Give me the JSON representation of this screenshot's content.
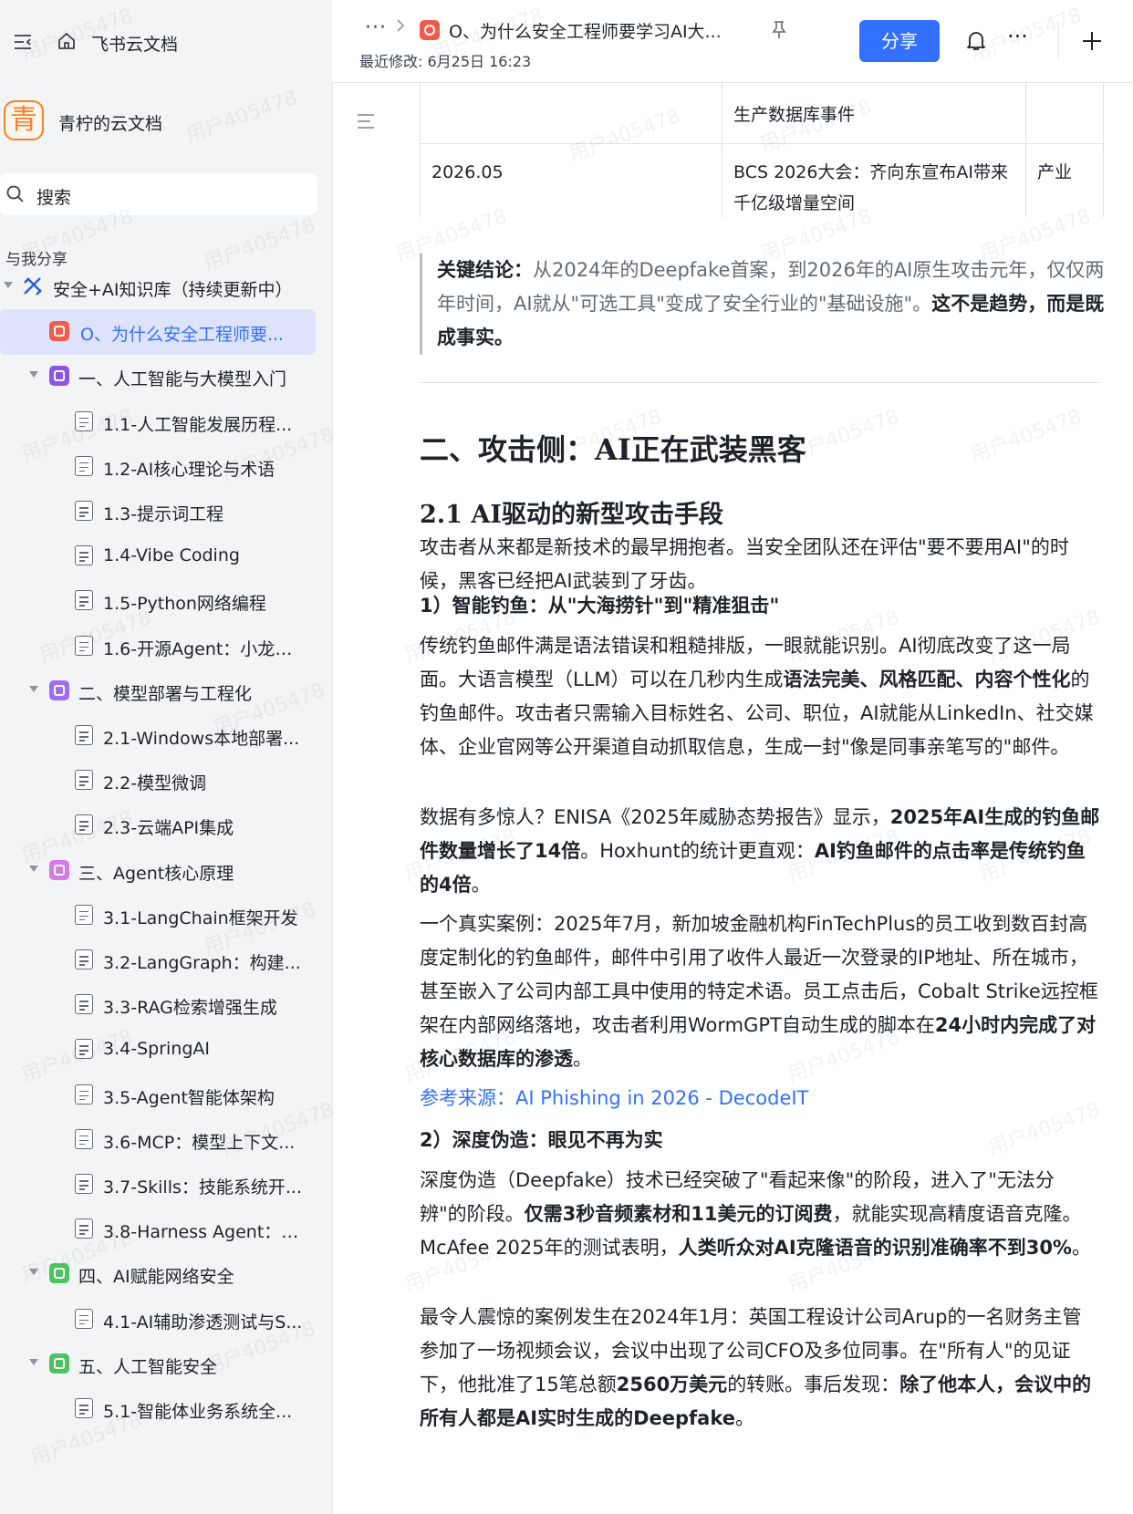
{
  "app": {
    "name": "飞书云文档"
  },
  "space": {
    "avatar_char": "青",
    "name": "青柠的云文档"
  },
  "search": {
    "label": "搜索"
  },
  "shared_label": "与我分享",
  "tree": [
    {
      "label": "安全+AI知识库（持续更新中）",
      "level": 0,
      "kind": "root"
    },
    {
      "label": "O、为什么安全工程师要...",
      "level": 1,
      "kind": "doc-red",
      "active": true
    },
    {
      "label": "一、人工智能与大模型入门",
      "level": 1,
      "kind": "folder-purple"
    },
    {
      "label": "1.1-人工智能发展历程...",
      "level": 2,
      "kind": "doc"
    },
    {
      "label": "1.2-AI核心理论与术语",
      "level": 2,
      "kind": "doc"
    },
    {
      "label": "1.3-提示词工程",
      "level": 2,
      "kind": "doc"
    },
    {
      "label": "1.4-Vibe Coding",
      "level": 2,
      "kind": "doc"
    },
    {
      "label": "1.5-Python网络编程",
      "level": 2,
      "kind": "doc"
    },
    {
      "label": "1.6-开源Agent：小龙虾...",
      "level": 2,
      "kind": "doc"
    },
    {
      "label": "二、模型部署与工程化",
      "level": 1,
      "kind": "folder-violet"
    },
    {
      "label": "2.1-Windows本地部署...",
      "level": 2,
      "kind": "doc"
    },
    {
      "label": "2.2-模型微调",
      "level": 2,
      "kind": "doc"
    },
    {
      "label": "2.3-云端API集成",
      "level": 2,
      "kind": "doc"
    },
    {
      "label": "三、Agent核心原理",
      "level": 1,
      "kind": "folder-pink"
    },
    {
      "label": "3.1-LangChain框架开发",
      "level": 2,
      "kind": "doc"
    },
    {
      "label": "3.2-LangGraph：构建...",
      "level": 2,
      "kind": "doc"
    },
    {
      "label": "3.3-RAG检索增强生成",
      "level": 2,
      "kind": "doc"
    },
    {
      "label": "3.4-SpringAI",
      "level": 2,
      "kind": "doc"
    },
    {
      "label": "3.5-Agent智能体架构",
      "level": 2,
      "kind": "doc"
    },
    {
      "label": "3.6-MCP：模型上下文...",
      "level": 2,
      "kind": "doc"
    },
    {
      "label": "3.7-Skills：技能系统开...",
      "level": 2,
      "kind": "doc"
    },
    {
      "label": "3.8-Harness Agent：驾...",
      "level": 2,
      "kind": "doc"
    },
    {
      "label": "四、AI赋能网络安全",
      "level": 1,
      "kind": "folder-green"
    },
    {
      "label": "4.1-AI辅助渗透测试与S...",
      "level": 2,
      "kind": "doc"
    },
    {
      "label": "五、人工智能安全",
      "level": 1,
      "kind": "folder-green"
    },
    {
      "label": "5.1-智能体业务系统全...",
      "level": 2,
      "kind": "doc"
    }
  ],
  "header": {
    "more": "···",
    "doc_title": "O、为什么安全工程师要学习AI大...",
    "modified": "最近修改: 6月25日 16:23",
    "share": "分享",
    "hmore": "···"
  },
  "timeline": {
    "rows": [
      {
        "date": "",
        "event_lines": [
          "生产数据库事件"
        ],
        "extra": ""
      },
      {
        "date": "2026.05",
        "event_lines": [
          "BCS 2026大会：齐向东宣布AI带来",
          "千亿级增量空间"
        ],
        "extra": "产业"
      }
    ]
  },
  "callout": {
    "label": "关键结论：",
    "text1": "从2024年的Deepfake首案，到2026年的AI原生攻击元年，仅仅两年时间，AI就从\"可选工具\"变成了安全行业的\"基础设施\"。",
    "text2": "这不是趋势，而是既成事实。"
  },
  "section": {
    "h2": "二、攻击侧：AI正在武装黑客",
    "h3": "2.1 AI驱动的新型攻击手段",
    "intro": "攻击者从来都是新技术的最早拥抱者。当安全团队还在评估\"要不要用AI\"的时候，黑客已经把AI武装到了牙齿。",
    "sub1": "1）智能钓鱼：从\"大海捞针\"到\"精准狙击\"",
    "p1a": "传统钓鱼邮件满是语法错误和粗糙排版，一眼就能识别。AI彻底改变了这一局面。大语言模型（LLM）可以在几秒内生成",
    "p1b": "语法完美、风格匹配、内容个性化",
    "p1c": "的钓鱼邮件。攻击者只需输入目标姓名、公司、职位，AI就能从LinkedIn、社交媒体、企业官网等公开渠道自动抓取信息，生成一封\"像是同事亲笔写的\"邮件。",
    "p2a": "数据有多惊人？ENISA《2025年威胁态势报告》显示，",
    "p2b": "2025年AI生成的钓鱼邮件数量增长了14倍",
    "p2c": "。Hoxhunt的统计更直观：",
    "p2d": "AI钓鱼邮件的点击率是传统钓鱼的4倍",
    "p2e": "。",
    "p3a": "一个真实案例：2025年7月，新加坡金融机构FinTechPlus的员工收到数百封高度定制化的钓鱼邮件，邮件中引用了收件人最近一次登录的IP地址、所在城市，甚至嵌入了公司内部工具中使用的特定术语。员工点击后，Cobalt Strike远控框架在内部网络落地，攻击者利用WormGPT自动生成的脚本在",
    "p3b": "24小时内完成了对核心数据库的渗透",
    "p3c": "。",
    "ref": "参考来源：AI Phishing in 2026 - DecodeIT",
    "sub2": "2）深度伪造：眼见不再为实",
    "p4a": "深度伪造（Deepfake）技术已经突破了\"看起来像\"的阶段，进入了\"无法分辨\"的阶段。",
    "p4b": "仅需3秒音频素材和11美元的订阅费",
    "p4c": "，就能实现高精度语音克隆。McAfee 2025年的测试表明，",
    "p4d": "人类听众对AI克隆语音的识别准确率不到30%",
    "p4e": "。",
    "p5a": "最令人震惊的案例发生在2024年1月：英国工程设计公司Arup的一名财务主管参加了一场视频会议，会议中出现了公司CFO及多位同事。在\"所有人\"的见证下，他批准了15笔总额",
    "p5b": "2560万美元",
    "p5c": "的转账。事后发现：",
    "p5d": "除了他本人，会议中的所有人都是AI实时生成的Deepfake",
    "p5e": "。"
  },
  "watermark_text": "用户405478",
  "colors": {
    "accent": "#3370ff",
    "sidebar_bg": "#f3f4f6",
    "active_bg": "#dce3fb",
    "doc_red": "#f25a4c",
    "brand_orange": "#f5822a"
  }
}
